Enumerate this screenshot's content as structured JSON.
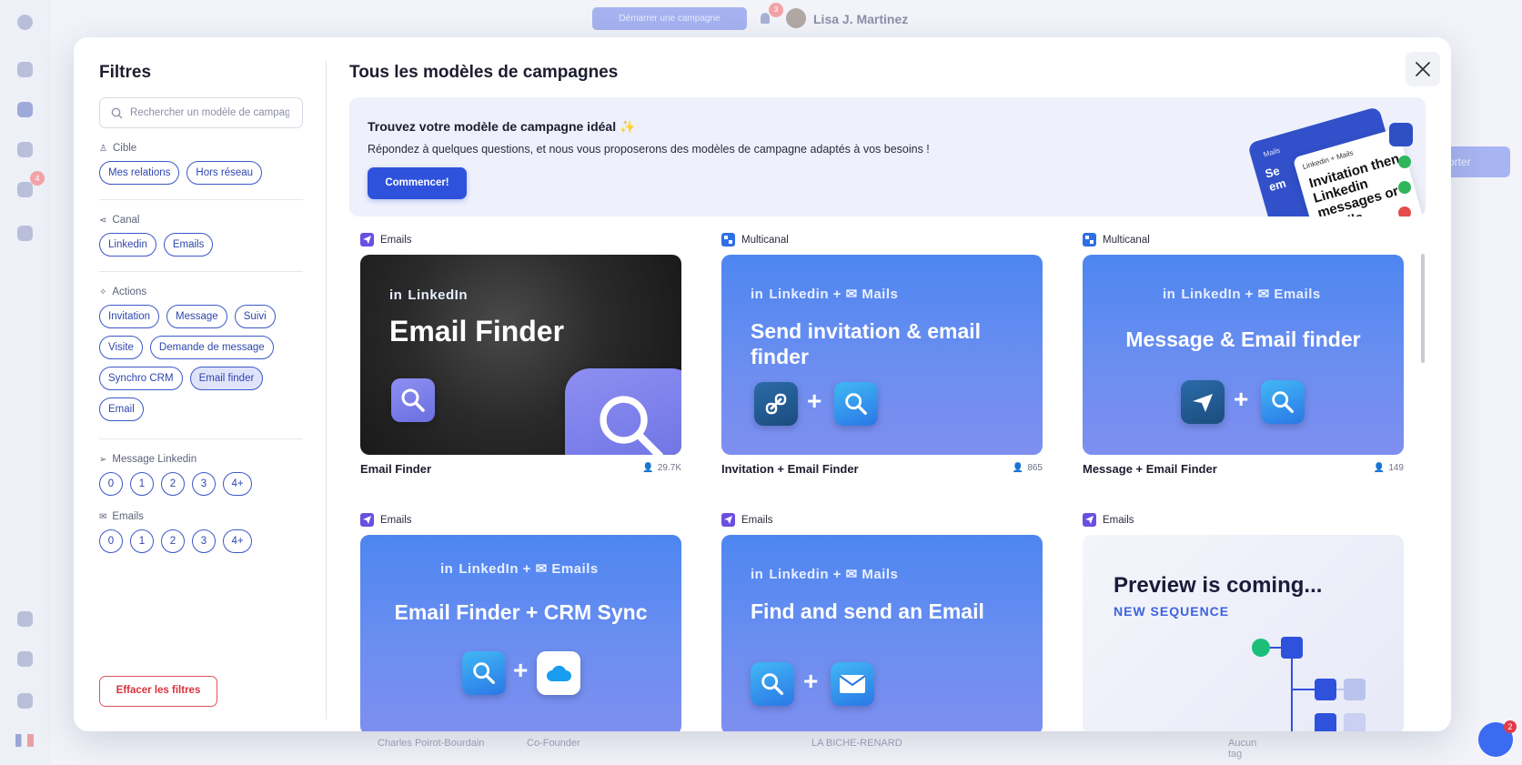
{
  "background": {
    "start_campaign": "Démarrer une campagne",
    "user_name": "Lisa J. Martinez",
    "bell_badge": "3",
    "sidebar_badge": "4",
    "right_button": "orter",
    "bottom_row": {
      "name": "Charles Poirot-Bourdain",
      "title": "Co-Founder",
      "company": "LA BICHE-RENARD",
      "tag": "Aucun tag"
    },
    "chat_badge": "2"
  },
  "filters": {
    "title": "Filtres",
    "search_placeholder": "Rechercher un modèle de campagne",
    "cible": {
      "label": "Cible",
      "chips": [
        "Mes relations",
        "Hors réseau"
      ]
    },
    "canal": {
      "label": "Canal",
      "chips": [
        "Linkedin",
        "Emails"
      ]
    },
    "actions": {
      "label": "Actions",
      "chips": [
        "Invitation",
        "Message",
        "Suivi",
        "Visite",
        "Demande de message",
        "Synchro CRM",
        "Email finder",
        "Email"
      ],
      "active": "Email finder"
    },
    "message_linkedin": {
      "label": "Message Linkedin",
      "chips": [
        "0",
        "1",
        "2",
        "3",
        "4+"
      ]
    },
    "emails": {
      "label": "Emails",
      "chips": [
        "0",
        "1",
        "2",
        "3",
        "4+"
      ]
    },
    "clear": "Effacer les filtres"
  },
  "main": {
    "title": "Tous les modèles de campagnes",
    "banner": {
      "title": "Trouvez votre modèle de campagne idéal ✨",
      "description": "Répondez à quelques questions, et nous vous proposerons des modèles de campagne adaptés à vos besoins !",
      "button": "Commencer!",
      "art_front_text": "Invitation then Linkedin messages or emails",
      "art_front_tag": "Linkedin + Mails",
      "art_back_tag": "Mails",
      "art_back_text": "Se em"
    },
    "templates": [
      {
        "type": "Emails",
        "name": "Email Finder",
        "count": "29.7K",
        "thumb_sub": "LinkedIn",
        "thumb_main": "Email Finder"
      },
      {
        "type": "Multicanal",
        "name": "Invitation + Email Finder",
        "count": "865",
        "thumb_sub": "Linkedin + ✉ Mails",
        "thumb_main": "Send invitation & email finder"
      },
      {
        "type": "Multicanal",
        "name": "Message + Email Finder",
        "count": "149",
        "thumb_sub": "LinkedIn + ✉ Emails",
        "thumb_main": "Message & Email finder"
      },
      {
        "type": "Emails",
        "name": "",
        "count": "",
        "thumb_sub": "LinkedIn + ✉ Emails",
        "thumb_main": "Email Finder + CRM Sync"
      },
      {
        "type": "Emails",
        "name": "",
        "count": "",
        "thumb_sub": "Linkedin + ✉ Mails",
        "thumb_main": "Find and send an Email"
      },
      {
        "type": "Emails",
        "name": "",
        "count": "",
        "thumb_sub": "NEW SEQUENCE",
        "thumb_main": "Preview is coming..."
      }
    ]
  },
  "colors": {
    "accent": "#2f52dc",
    "chip_border": "#3d58c9",
    "danger": "#d8323c",
    "thumb_blue": "#5b8af0"
  }
}
